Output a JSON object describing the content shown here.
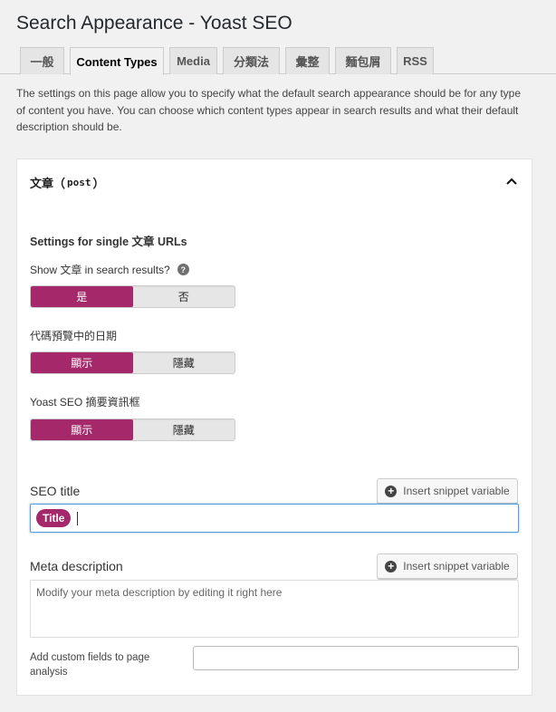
{
  "page": {
    "title": "Search Appearance - Yoast SEO"
  },
  "tabs": [
    {
      "label": "一般",
      "active": false
    },
    {
      "label": "Content Types",
      "active": true
    },
    {
      "label": "Media",
      "active": false
    },
    {
      "label": "分類法",
      "active": false
    },
    {
      "label": "彙整",
      "active": false
    },
    {
      "label": "麵包屑",
      "active": false
    },
    {
      "label": "RSS",
      "active": false
    }
  ],
  "intro": "The settings on this page allow you to specify what the default search appearance should be for any type of content you have. You can choose which content types appear in search results and what their default description should be.",
  "card": {
    "title_prefix": "文章（",
    "title_code": "post",
    "title_suffix": "）",
    "section_title": "Settings for single 文章 URLs",
    "show_in_results": {
      "label": "Show 文章 in search results?",
      "help": "?",
      "options": [
        "是",
        "否"
      ],
      "selected": 0
    },
    "date_in_preview": {
      "label": "代碼預覽中的日期",
      "options": [
        "顯示",
        "隱藏"
      ],
      "selected": 0
    },
    "meta_box": {
      "label": "Yoast SEO 摘要資訊框",
      "options": [
        "顯示",
        "隱藏"
      ],
      "selected": 0
    },
    "seo_title": {
      "label": "SEO title",
      "button": "Insert snippet variable",
      "chip": "Title"
    },
    "meta_description": {
      "label": "Meta description",
      "button": "Insert snippet variable",
      "placeholder": "Modify your meta description by editing it right here"
    },
    "custom_fields": {
      "label": "Add custom fields to page analysis",
      "value": ""
    }
  },
  "colors": {
    "accent": "#a4286a",
    "focus_border": "#5b9dd9",
    "background": "#f1f1f1"
  }
}
